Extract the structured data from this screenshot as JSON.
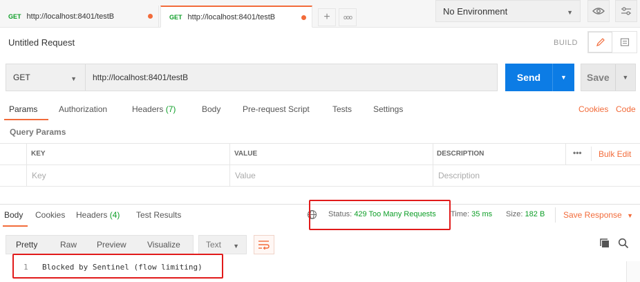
{
  "tabs": [
    {
      "method": "GET",
      "url": "http://localhost:8401/testB"
    },
    {
      "method": "GET",
      "url": "http://localhost:8401/testB"
    }
  ],
  "tabbar": {
    "new_tab_symbol": "+",
    "more_symbol": "ooo"
  },
  "environment": {
    "selected": "No Environment"
  },
  "request": {
    "title": "Untitled Request",
    "build_label": "BUILD",
    "method": "GET",
    "url": "http://localhost:8401/testB",
    "send_label": "Send",
    "save_label": "Save"
  },
  "request_tabs": {
    "params": "Params",
    "authorization": "Authorization",
    "headers": "Headers",
    "headers_count": "(7)",
    "body": "Body",
    "prerequest": "Pre-request Script",
    "tests": "Tests",
    "settings": "Settings",
    "cookies": "Cookies",
    "code": "Code"
  },
  "query_params": {
    "title": "Query Params",
    "columns": {
      "key": "KEY",
      "value": "VALUE",
      "description": "DESCRIPTION"
    },
    "more_symbol": "•••",
    "bulk_edit": "Bulk Edit",
    "placeholders": {
      "key": "Key",
      "value": "Value",
      "description": "Description"
    }
  },
  "response_tabs": {
    "body": "Body",
    "cookies": "Cookies",
    "headers": "Headers",
    "headers_count": "(4)",
    "test_results": "Test Results"
  },
  "response_meta": {
    "status_label": "Status:",
    "status_value": "429 Too Many Requests",
    "time_label": "Time:",
    "time_value": "35 ms",
    "size_label": "Size:",
    "size_value": "182 B",
    "save_response": "Save Response"
  },
  "body_formats": {
    "pretty": "Pretty",
    "raw": "Raw",
    "preview": "Preview",
    "visualize": "Visualize",
    "text_type": "Text"
  },
  "response_body": {
    "line_number": "1",
    "line_text": "Blocked by Sentinel (flow limiting)"
  },
  "colors": {
    "accent": "#f26b3a",
    "send": "#0c7ce5",
    "success": "#0d9e27",
    "highlight_box": "#e11a1a"
  }
}
